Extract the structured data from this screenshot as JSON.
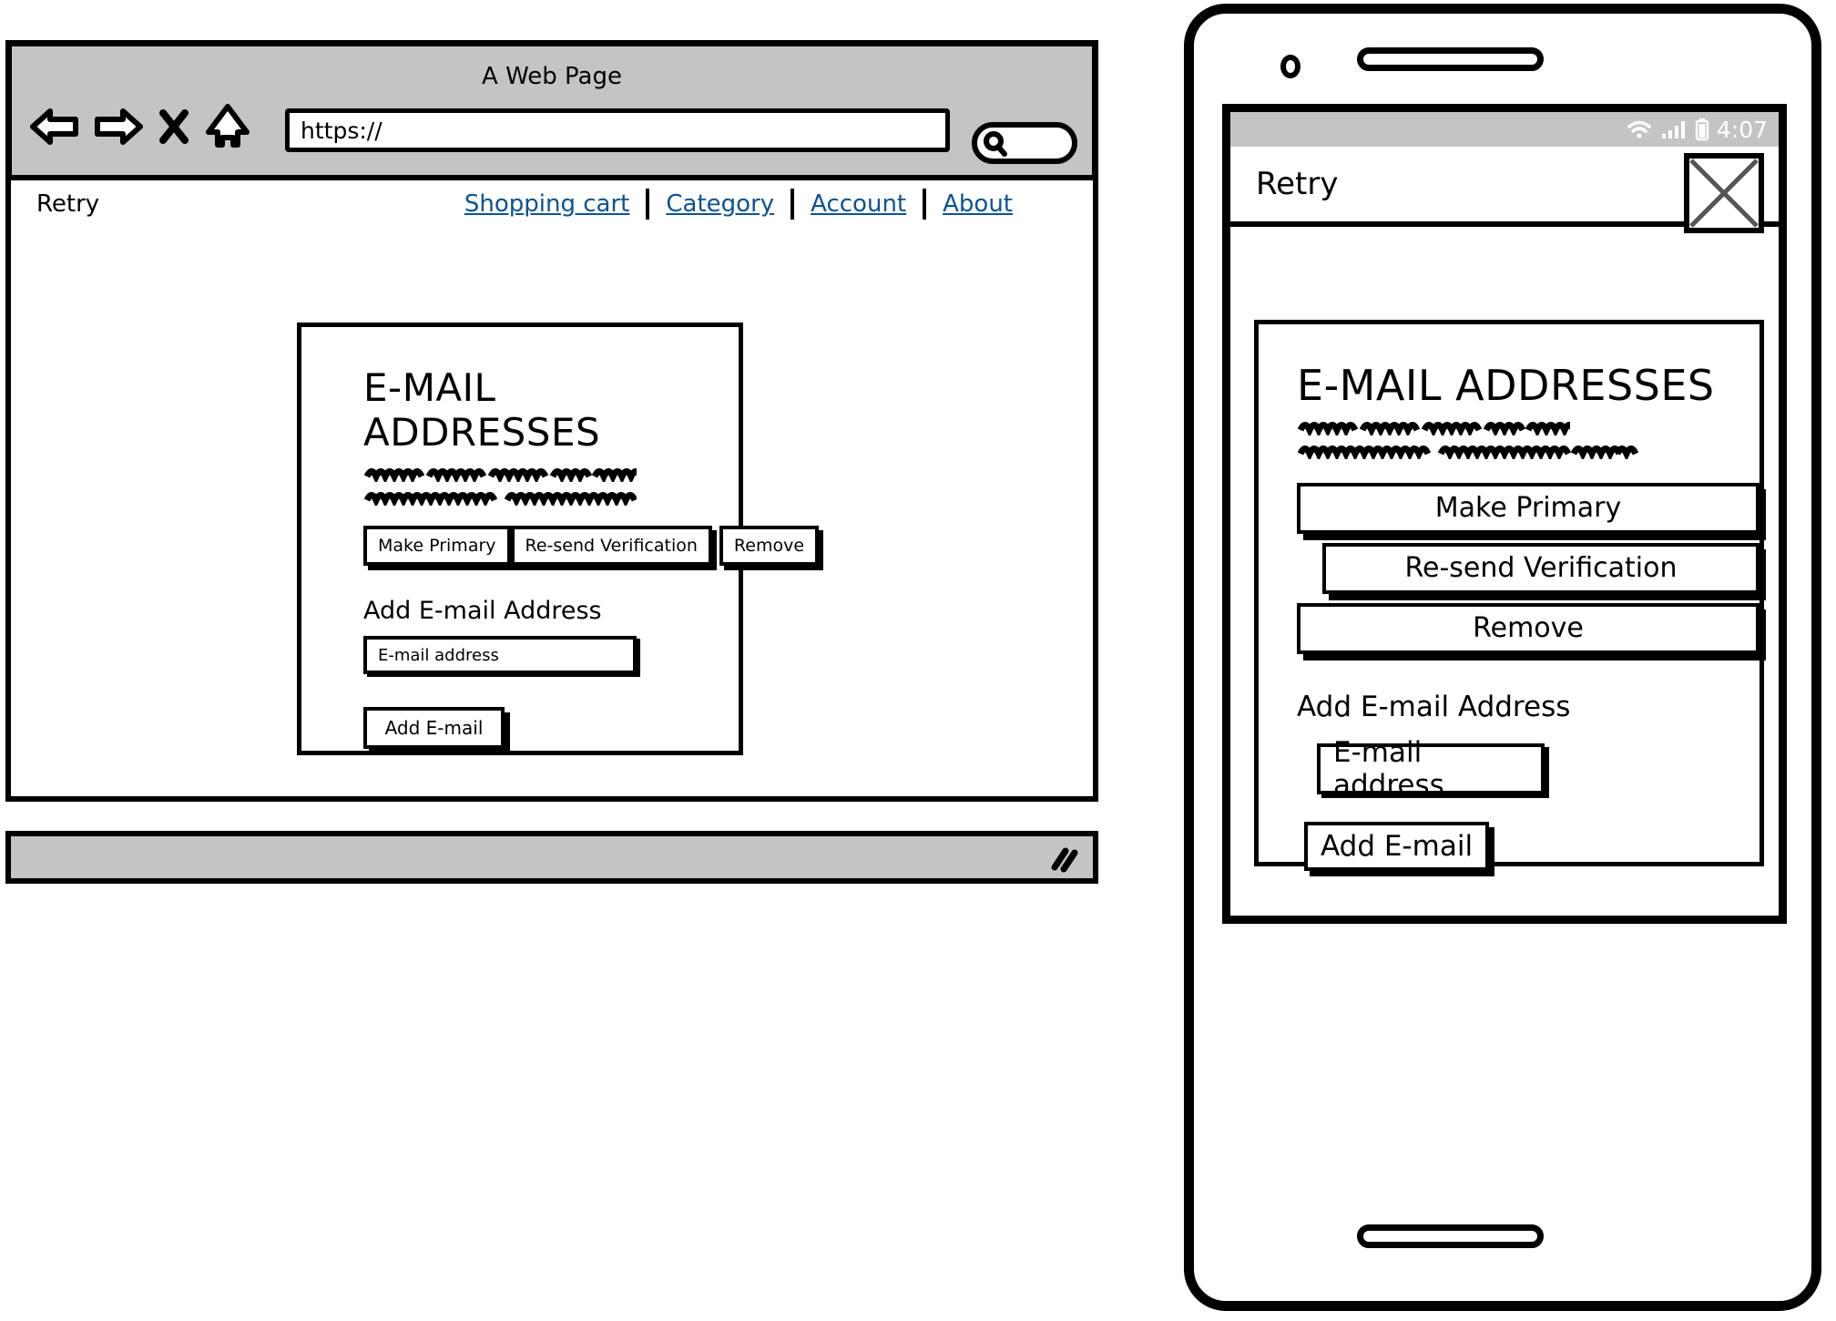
{
  "browser": {
    "title": "A Web Page",
    "toolbar": {
      "back_icon": "back-arrow-icon",
      "forward_icon": "forward-arrow-icon",
      "stop_icon": "close-x-icon",
      "home_icon": "home-icon",
      "search_icon": "search-icon"
    },
    "url_value": "https://",
    "url_placeholder": "https://",
    "site_nav": {
      "brand": "Retry",
      "links": [
        {
          "label": "Shopping cart"
        },
        {
          "label": "Category"
        },
        {
          "label": "Account"
        },
        {
          "label": "About"
        }
      ]
    },
    "resize_grip_icon": "resize-grip-icon"
  },
  "content": {
    "heading": "E-MAIL ADDRESSES",
    "placeholder_lines": [
      {
        "words": [
          4,
          4,
          4,
          3,
          4
        ]
      },
      {
        "words": [
          9,
          9
        ]
      }
    ],
    "buttons": [
      {
        "label": "Make Primary"
      },
      {
        "label": "Re-send Verification"
      },
      {
        "label": "Remove"
      }
    ],
    "add_section": {
      "label": "Add E-mail Address",
      "input_placeholder": "E-mail address",
      "input_value": "E-mail address",
      "submit_label": "Add E-mail"
    }
  },
  "phone": {
    "status_bar": {
      "time": "4:07",
      "wifi_icon": "wifi-icon",
      "signal_icon": "signal-bars-icon",
      "battery_icon": "battery-icon"
    },
    "appbar": {
      "title": "Retry",
      "menu_icon": "image-placeholder-x-icon"
    },
    "content": {
      "heading": "E-MAIL ADDRESSES",
      "placeholder_lines": [
        {
          "words": [
            4,
            4,
            4,
            3,
            4
          ]
        },
        {
          "words": [
            9,
            9,
            4,
            3,
            2
          ]
        }
      ],
      "buttons": [
        {
          "label": "Make Primary"
        },
        {
          "label": "Re-send Verification"
        },
        {
          "label": "Remove"
        }
      ],
      "add_section": {
        "label": "Add E-mail Address",
        "input_placeholder": "E-mail address",
        "input_value": "E-mail address",
        "submit_label": "Add E-mail"
      }
    },
    "camera_icon": "camera-icon",
    "speaker_icon": "speaker-grill-icon",
    "home_icon": "home-button-icon"
  },
  "colors": {
    "chrome_gray": "#c4c4c4",
    "link_blue": "#0b5394",
    "ink": "#000000",
    "paper": "#ffffff"
  }
}
